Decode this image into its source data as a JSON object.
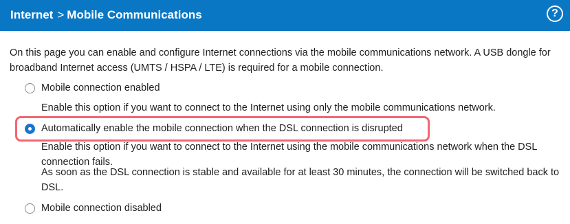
{
  "header": {
    "breadcrumb_root": "Internet",
    "breadcrumb_separator": ">",
    "breadcrumb_current": "Mobile Communications",
    "help_label": "?"
  },
  "intro": "On this page you can enable and configure Internet connections via the mobile communications network. A USB dongle for broadband Internet access (UMTS / HSPA / LTE) is required for a mobile connection.",
  "options": [
    {
      "label": "Mobile connection enabled",
      "selected": false,
      "description": "Enable this option if you want to connect to the Internet using only the mobile communications network."
    },
    {
      "label": "Automatically enable the mobile connection when the DSL connection is disrupted",
      "selected": true,
      "description": "Enable this option if you want to connect to the Internet using the mobile communications network when the DSL connection fails.",
      "description_2": "As soon as the DSL connection is stable and available for at least 30 minutes, the connection will be switched back to DSL."
    },
    {
      "label": "Mobile connection disabled",
      "selected": false
    }
  ],
  "colors": {
    "header_bg": "#0a77c4",
    "highlight_border": "#f26672",
    "radio_selected": "#1b74cf"
  }
}
